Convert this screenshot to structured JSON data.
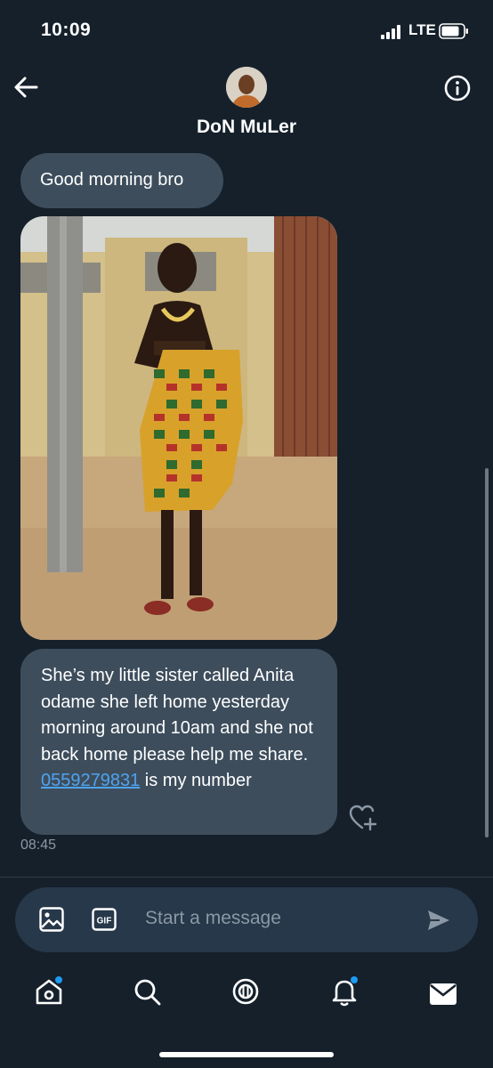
{
  "status_bar": {
    "time": "10:09",
    "network": "LTE"
  },
  "header": {
    "contact_name": "DoN MuLer"
  },
  "messages": [
    {
      "type": "text",
      "text": "Good morning bro"
    },
    {
      "type": "image"
    },
    {
      "type": "text",
      "text_before": "She’s my little sister called Anita odame she left home yesterday morning around 10am and she not back home please help me share.",
      "phone": "0559279831",
      "text_after": " is my number"
    }
  ],
  "timestamp": "08:45",
  "composer": {
    "placeholder": "Start a message"
  },
  "tab_bar": {
    "items": [
      "home-icon",
      "search-icon",
      "spaces-icon",
      "notifications-icon",
      "messages-icon"
    ]
  },
  "colors": {
    "background": "#15202b",
    "bubble": "#3d4d5c",
    "link": "#4fa3f0",
    "accent": "#1d9bf0",
    "muted": "#8b98a5"
  }
}
